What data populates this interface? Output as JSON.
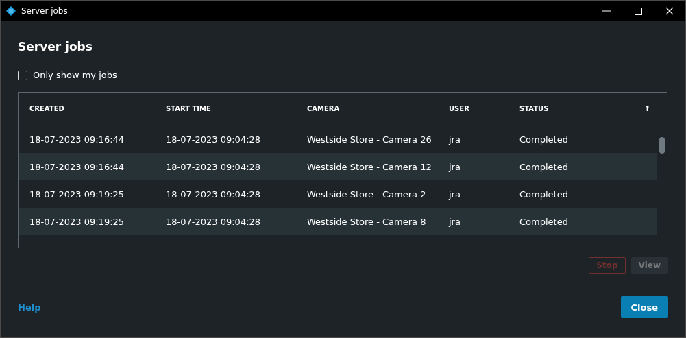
{
  "window": {
    "title": "Server jobs"
  },
  "heading": "Server jobs",
  "only_mine": {
    "label": "Only show my jobs",
    "checked": false
  },
  "table": {
    "columns": [
      "CREATED",
      "START TIME",
      "CAMERA",
      "USER",
      "STATUS"
    ],
    "sort_indicator": "↑",
    "rows": [
      {
        "cells": [
          "18-07-2023 09:16:44",
          "18-07-2023 09:04:28",
          "Westside Store - Camera 26",
          "jra",
          "Completed"
        ]
      },
      {
        "cells": [
          "18-07-2023 09:16:44",
          "18-07-2023 09:04:28",
          "Westside Store - Camera 12",
          "jra",
          "Completed"
        ]
      },
      {
        "cells": [
          "18-07-2023 09:19:25",
          "18-07-2023 09:04:28",
          "Westside Store - Camera 2",
          "jra",
          "Completed"
        ]
      },
      {
        "cells": [
          "18-07-2023 09:19:25",
          "18-07-2023 09:04:28",
          "Westside Store - Camera 8",
          "jra",
          "Completed"
        ]
      }
    ]
  },
  "actions": [
    {
      "label": "Stop",
      "kind": "danger",
      "disabled": true
    },
    {
      "label": "View",
      "kind": "plain",
      "disabled": true
    }
  ],
  "help": "Help",
  "close": "Close"
}
